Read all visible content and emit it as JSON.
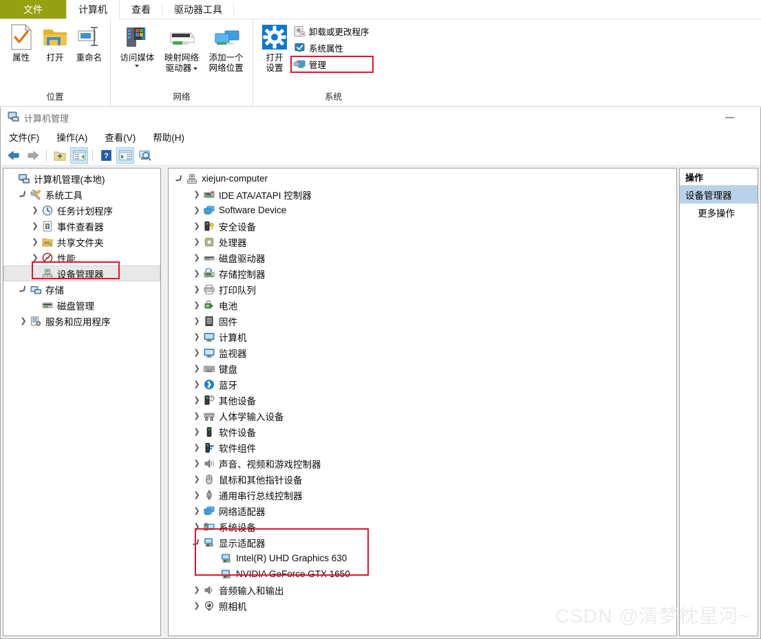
{
  "ribbon": {
    "tabs": [
      {
        "label": "文件",
        "kind": "file"
      },
      {
        "label": "计算机",
        "kind": "active"
      },
      {
        "label": "查看",
        "kind": "normal"
      },
      {
        "label": "驱动器工具",
        "kind": "normal"
      }
    ],
    "groups": [
      {
        "title": "位置",
        "big": [
          {
            "label": "属性",
            "icon": "properties-icon"
          },
          {
            "label": "打开",
            "icon": "open-folder-icon"
          },
          {
            "label": "重命名",
            "icon": "rename-icon"
          }
        ]
      },
      {
        "title": "网络",
        "big": [
          {
            "label": "访问媒体",
            "label2": "",
            "icon": "access-media-icon",
            "dropdown": true
          },
          {
            "label": "映射网络",
            "label2": "驱动器",
            "icon": "map-network-drive-icon",
            "dropdown_inline": true
          },
          {
            "label": "添加一个",
            "label2": "网络位置",
            "icon": "add-network-location-icon"
          }
        ]
      },
      {
        "title": "系统",
        "big": [
          {
            "label": "打开",
            "label2": "设置",
            "icon": "open-settings-icon"
          }
        ],
        "small": [
          {
            "label": "卸载或更改程序",
            "icon": "uninstall-program-icon",
            "highlighted": false
          },
          {
            "label": "系统属性",
            "icon": "system-properties-icon",
            "highlighted": false
          },
          {
            "label": "管理",
            "icon": "manage-icon",
            "highlighted": true
          }
        ]
      }
    ]
  },
  "mmc": {
    "title": "计算机管理",
    "title_icon": "computer-management-icon",
    "minimize_label": "最小化",
    "menu": [
      {
        "label": "文件(F)"
      },
      {
        "label": "操作(A)"
      },
      {
        "label": "查看(V)"
      },
      {
        "label": "帮助(H)"
      }
    ],
    "toolbar": [
      {
        "name": "back-icon",
        "pressed": false
      },
      {
        "name": "forward-icon",
        "pressed": false
      },
      {
        "name": "up-folder-icon",
        "pressed": false
      },
      {
        "name": "show-hide-console-tree-icon",
        "pressed": true
      },
      {
        "name": "help-icon",
        "pressed": false
      },
      {
        "name": "show-hide-action-pane-icon",
        "pressed": true
      },
      {
        "name": "scan-for-hardware-changes-icon",
        "pressed": false
      }
    ],
    "console_tree": [
      {
        "label": "计算机管理(本地)",
        "level": 0,
        "expander": "expanded-none",
        "icon": "computer-management-icon",
        "selected": false
      },
      {
        "label": "系统工具",
        "level": 1,
        "expander": "expanded",
        "icon": "system-tools-icon",
        "selected": false
      },
      {
        "label": "任务计划程序",
        "level": 2,
        "expander": "collapsed",
        "icon": "task-scheduler-icon",
        "selected": false
      },
      {
        "label": "事件查看器",
        "level": 2,
        "expander": "collapsed",
        "icon": "event-viewer-icon",
        "selected": false
      },
      {
        "label": "共享文件夹",
        "level": 2,
        "expander": "collapsed",
        "icon": "shared-folders-icon",
        "selected": false
      },
      {
        "label": "性能",
        "level": 2,
        "expander": "collapsed",
        "icon": "performance-icon",
        "selected": false
      },
      {
        "label": "设备管理器",
        "level": 2,
        "expander": "none",
        "icon": "device-manager-icon",
        "selected": true
      },
      {
        "label": "存储",
        "level": 1,
        "expander": "expanded",
        "icon": "storage-icon",
        "selected": false
      },
      {
        "label": "磁盘管理",
        "level": 2,
        "expander": "none",
        "icon": "disk-management-icon",
        "selected": false
      },
      {
        "label": "服务和应用程序",
        "level": 1,
        "expander": "collapsed",
        "icon": "services-and-applications-icon",
        "selected": false
      }
    ],
    "device_tree": [
      {
        "label": "xiejun-computer",
        "level": 0,
        "expander": "expanded",
        "icon": "computer-node-icon"
      },
      {
        "label": "IDE ATA/ATAPI 控制器",
        "level": 1,
        "expander": "collapsed",
        "icon": "ide-controller-icon"
      },
      {
        "label": "Software Device",
        "level": 1,
        "expander": "collapsed",
        "icon": "software-device-icon"
      },
      {
        "label": "安全设备",
        "level": 1,
        "expander": "collapsed",
        "icon": "security-device-icon"
      },
      {
        "label": "处理器",
        "level": 1,
        "expander": "collapsed",
        "icon": "processor-icon"
      },
      {
        "label": "磁盘驱动器",
        "level": 1,
        "expander": "collapsed",
        "icon": "disk-drive-icon"
      },
      {
        "label": "存储控制器",
        "level": 1,
        "expander": "collapsed",
        "icon": "storage-controller-icon"
      },
      {
        "label": "打印队列",
        "level": 1,
        "expander": "collapsed",
        "icon": "print-queue-icon"
      },
      {
        "label": "电池",
        "level": 1,
        "expander": "collapsed",
        "icon": "battery-icon"
      },
      {
        "label": "固件",
        "level": 1,
        "expander": "collapsed",
        "icon": "firmware-icon"
      },
      {
        "label": "计算机",
        "level": 1,
        "expander": "collapsed",
        "icon": "computer-icon"
      },
      {
        "label": "监视器",
        "level": 1,
        "expander": "collapsed",
        "icon": "monitor-icon"
      },
      {
        "label": "键盘",
        "level": 1,
        "expander": "collapsed",
        "icon": "keyboard-icon"
      },
      {
        "label": "蓝牙",
        "level": 1,
        "expander": "collapsed",
        "icon": "bluetooth-icon"
      },
      {
        "label": "其他设备",
        "level": 1,
        "expander": "collapsed",
        "icon": "other-devices-icon"
      },
      {
        "label": "人体学输入设备",
        "level": 1,
        "expander": "collapsed",
        "icon": "hid-icon"
      },
      {
        "label": "软件设备",
        "level": 1,
        "expander": "collapsed",
        "icon": "software-devices-icon"
      },
      {
        "label": "软件组件",
        "level": 1,
        "expander": "collapsed",
        "icon": "software-components-icon"
      },
      {
        "label": "声音、视频和游戏控制器",
        "level": 1,
        "expander": "collapsed",
        "icon": "sound-video-game-controllers-icon"
      },
      {
        "label": "鼠标和其他指针设备",
        "level": 1,
        "expander": "collapsed",
        "icon": "mouse-icon"
      },
      {
        "label": "通用串行总线控制器",
        "level": 1,
        "expander": "collapsed",
        "icon": "usb-controller-icon"
      },
      {
        "label": "网络适配器",
        "level": 1,
        "expander": "collapsed",
        "icon": "network-adapter-icon"
      },
      {
        "label": "系统设备",
        "level": 1,
        "expander": "collapsed",
        "icon": "system-devices-icon"
      },
      {
        "label": "显示适配器",
        "level": 1,
        "expander": "expanded",
        "icon": "display-adapter-icon"
      },
      {
        "label": "Intel(R) UHD Graphics 630",
        "level": 2,
        "expander": "none",
        "icon": "display-adapter-child-icon"
      },
      {
        "label": "NVIDIA GeForce GTX 1650",
        "level": 2,
        "expander": "none",
        "icon": "display-adapter-child-icon"
      },
      {
        "label": "音频输入和输出",
        "level": 1,
        "expander": "collapsed",
        "icon": "audio-io-icon"
      },
      {
        "label": "照相机",
        "level": 1,
        "expander": "collapsed",
        "icon": "camera-icon"
      }
    ],
    "actions_pane": {
      "header": "操作",
      "selected_item": "设备管理器",
      "items": [
        "更多操作"
      ]
    }
  },
  "watermark": "CSDN @清梦枕星河~",
  "colors": {
    "file_tab": "#96a112",
    "annotation_red": "#e8112d",
    "action_selected": "#b8d2ea",
    "toolbar_toggle_on": "#cfe8f7",
    "tree_selected": "#e8e8e8"
  }
}
